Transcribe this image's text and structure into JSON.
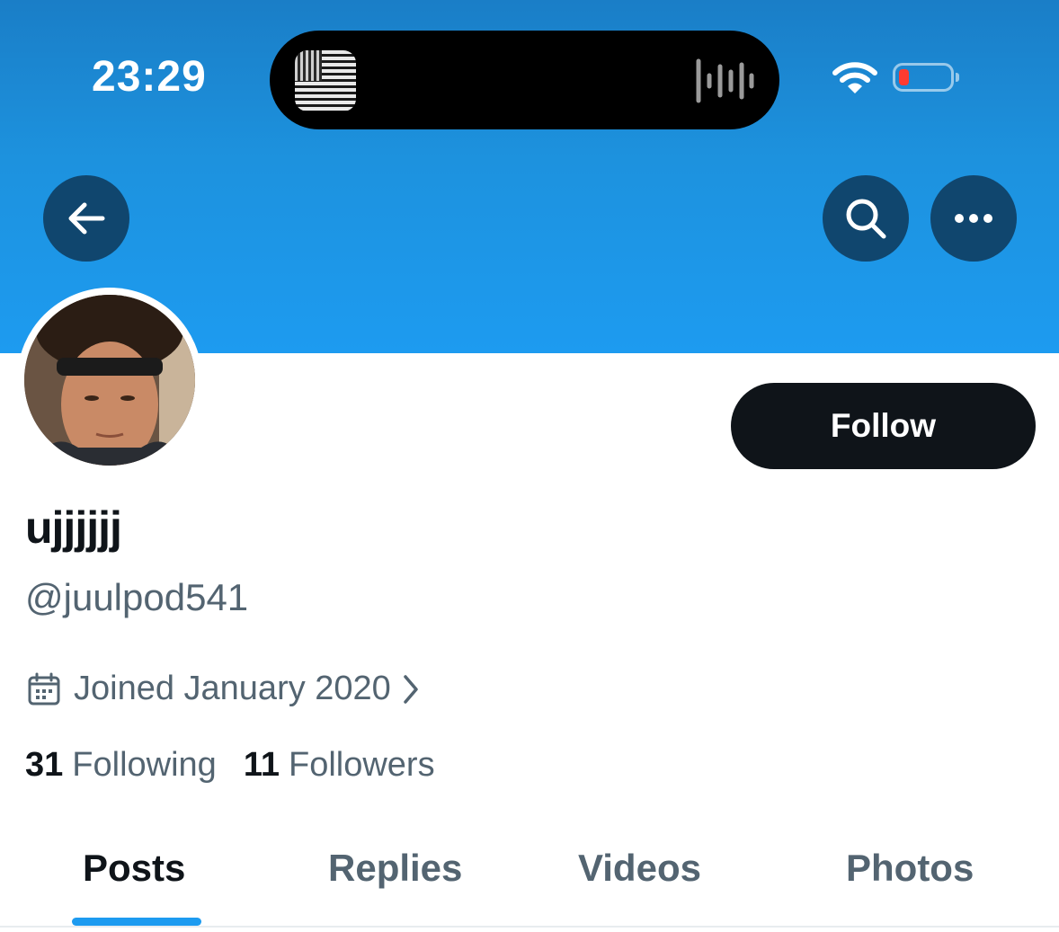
{
  "status_bar": {
    "time": "23:29",
    "battery_level_percent": 10,
    "battery_color": "#ff3b30",
    "icons": [
      "now-playing-artwork",
      "audio-waveform-icon",
      "wifi-icon",
      "battery-icon"
    ]
  },
  "header": {
    "back_icon": "arrow-left-icon",
    "search_icon": "search-icon",
    "more_icon": "more-horizontal-icon",
    "banner_color": "#1d9bf0"
  },
  "profile": {
    "display_name": "ujjjjjj",
    "handle": "@juulpod541",
    "joined": "Joined January 2020",
    "following_count": "31",
    "following_label": "Following",
    "followers_count": "11",
    "followers_label": "Followers",
    "follow_label": "Follow"
  },
  "tabs": [
    {
      "label": "Posts",
      "active": true
    },
    {
      "label": "Replies",
      "active": false
    },
    {
      "label": "Videos",
      "active": false
    },
    {
      "label": "Photos",
      "active": false
    }
  ],
  "colors": {
    "accent": "#1d9bf0",
    "text_primary": "#0f1419",
    "text_secondary": "#536471"
  }
}
